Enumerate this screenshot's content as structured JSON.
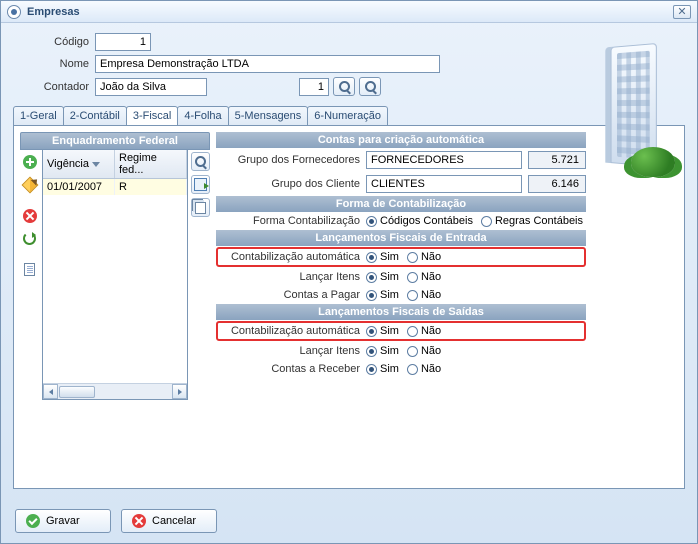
{
  "window": {
    "title": "Empresas"
  },
  "header": {
    "codigo_label": "Código",
    "codigo_value": "1",
    "nome_label": "Nome",
    "nome_value": "Empresa Demonstração LTDA",
    "contador_label": "Contador",
    "contador_value": "João da Silva",
    "contador_num": "1"
  },
  "tabs": [
    "1-Geral",
    "2-Contábil",
    "3-Fiscal",
    "4-Folha",
    "5-Mensagens",
    "6-Numeração"
  ],
  "left": {
    "title": "Enquadramento Federal",
    "col1": "Vigência",
    "col2": "Regime fed...",
    "row1_vig": "01/01/2007",
    "row1_reg": "R"
  },
  "contas": {
    "section": "Contas para criação automática",
    "fornec_label": "Grupo dos Fornecedores",
    "fornec_value": "FORNECEDORES",
    "fornec_num": "5.721",
    "cliente_label": "Grupo dos Cliente",
    "cliente_value": "CLIENTES",
    "cliente_num": "6.146"
  },
  "forma": {
    "section": "Forma de Contabilização",
    "label": "Forma Contabilização",
    "opt1": "Códigos Contábeis",
    "opt2": "Regras Contábeis"
  },
  "entrada": {
    "section": "Lançamentos Fiscais de Entrada",
    "auto_label": "Contabilização automática",
    "itens_label": "Lançar Itens",
    "pagar_label": "Contas a Pagar"
  },
  "saidas": {
    "section": "Lançamentos Fiscais de Saídas",
    "auto_label": "Contabilização automática",
    "itens_label": "Lançar Itens",
    "receber_label": "Contas a Receber"
  },
  "opts": {
    "sim": "Sim",
    "nao": "Não"
  },
  "footer": {
    "gravar": "Gravar",
    "cancelar": "Cancelar"
  }
}
